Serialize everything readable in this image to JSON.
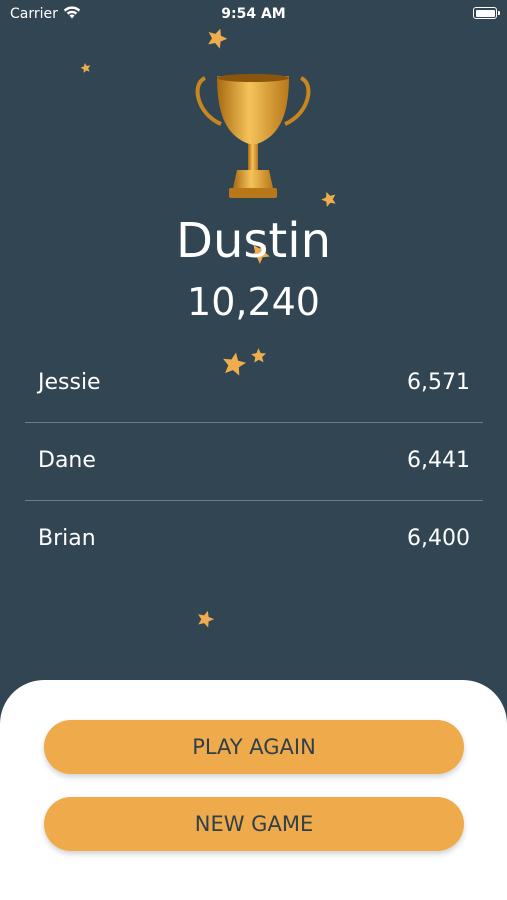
{
  "status_bar": {
    "carrier": "Carrier",
    "time": "9:54 AM"
  },
  "winner": {
    "name": "Dustin",
    "score": "10,240"
  },
  "rankings": [
    {
      "name": "Jessie",
      "score": "6,571"
    },
    {
      "name": "Dane",
      "score": "6,441"
    },
    {
      "name": "Brian",
      "score": "6,400"
    }
  ],
  "buttons": {
    "play_again": "PLAY AGAIN",
    "new_game": "NEW GAME"
  },
  "colors": {
    "background": "#314553",
    "accent": "#eeaa4b",
    "star": "#f0ad4e",
    "sheet": "#ffffff"
  },
  "icons": {
    "trophy": "trophy-icon",
    "star": "star-icon",
    "wifi": "wifi-icon",
    "battery": "battery-icon"
  }
}
